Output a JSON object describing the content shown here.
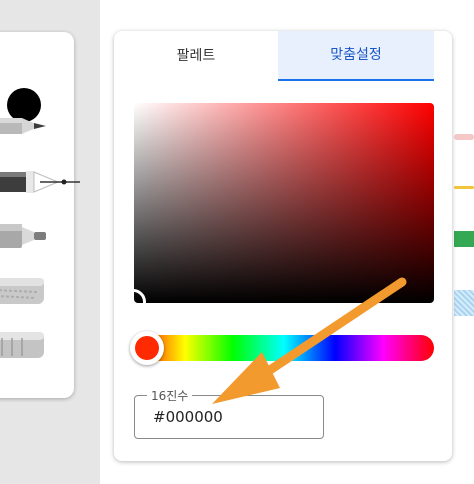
{
  "picker": {
    "tabs": [
      {
        "label": "팔레트",
        "selected": false
      },
      {
        "label": "맞춤설정",
        "selected": true
      }
    ],
    "hex": {
      "label": "16진수",
      "value": "#000000"
    },
    "hue_color": "#ff2a00",
    "selected_color": "#000000"
  },
  "tools": {
    "current_color": "#000000",
    "items": [
      "pencil-icon",
      "fountain-pen-icon",
      "marker-icon",
      "chalk-icon",
      "eraser-icon"
    ]
  },
  "colors": {
    "accent": "#1a73e8",
    "annotation_arrow": "#f39a2e"
  }
}
